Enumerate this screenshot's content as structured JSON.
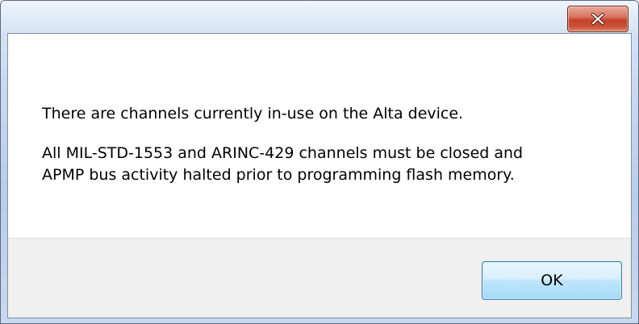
{
  "dialog": {
    "close_icon": "close-icon",
    "message_line_1": "There are channels currently in-use on the Alta device.",
    "message_line_2": "All MIL-STD-1553 and ARINC-429 channels must be closed and",
    "message_line_3": "APMP bus activity halted prior to programming flash memory.",
    "ok_label": "OK",
    "colors": {
      "close_button": "#c7432a",
      "ok_button_border": "#3c7fb1",
      "button_area": "#f0f0f0",
      "frame": "#c7d8ee"
    }
  }
}
